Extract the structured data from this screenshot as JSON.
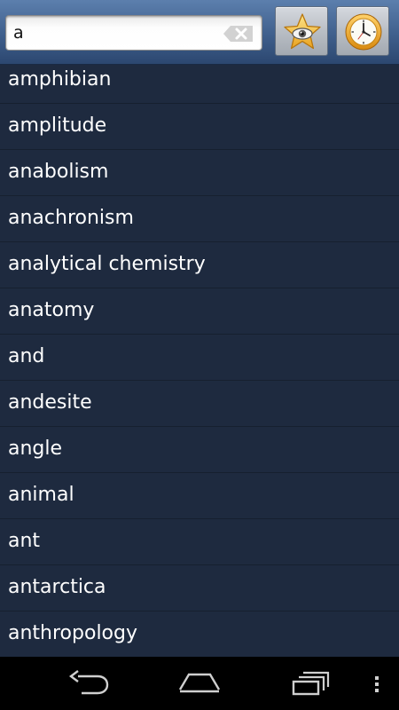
{
  "search": {
    "value": "a",
    "placeholder": ""
  },
  "toolbar": {
    "favorites_icon": "star-eye-icon",
    "history_icon": "clock-icon",
    "clear_icon": "clear-text-icon"
  },
  "words": [
    "amphibian",
    "amplitude",
    "anabolism",
    "anachronism",
    "analytical chemistry",
    "anatomy",
    "and",
    "andesite",
    "angle",
    "animal",
    "ant",
    "antarctica",
    "anthropology"
  ],
  "navbar": {
    "back_icon": "back-icon",
    "home_icon": "home-icon",
    "recent_icon": "recent-apps-icon",
    "menu_icon": "overflow-menu-icon"
  },
  "colors": {
    "list_background": "#1e2a3f",
    "list_divider": "#16202f",
    "header_top": "#5c7fad",
    "header_bottom": "#2c4770",
    "text": "#ffffff",
    "navbar": "#000000"
  }
}
